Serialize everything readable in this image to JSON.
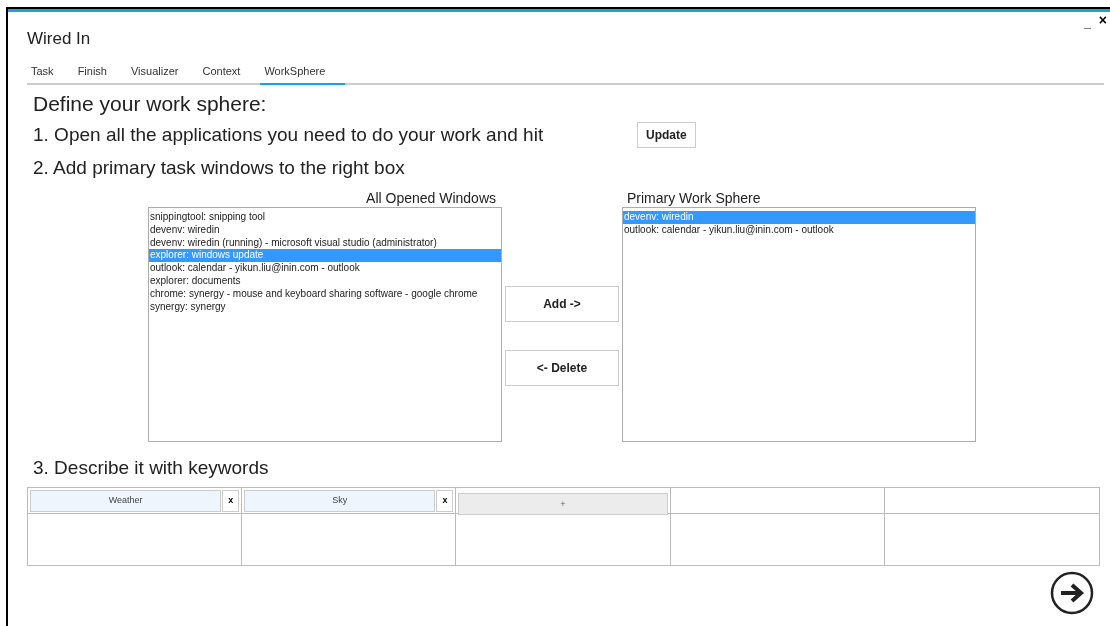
{
  "window": {
    "title": "Wired In",
    "controls": [
      {
        "kind": "minimize",
        "label": "_"
      },
      {
        "kind": "close",
        "label": "×"
      }
    ]
  },
  "tabs": [
    {
      "label": "Task",
      "selected": false
    },
    {
      "label": "Finish",
      "selected": false
    },
    {
      "label": "Visualizer",
      "selected": false
    },
    {
      "label": "Context",
      "selected": false
    },
    {
      "label": "WorkSphere",
      "selected": true
    }
  ],
  "heading": "Define your work sphere:",
  "step_1": {
    "text": "1. Open all the applications you need to do your work and hit",
    "button": "Update"
  },
  "step_2": "2. Add primary task windows to the right box",
  "all_windows": {
    "title": "All Opened Windows",
    "items": [
      {
        "label": "snippingtool: snipping tool",
        "selected": false
      },
      {
        "label": "devenv: wiredin",
        "selected": false
      },
      {
        "label": "devenv: wiredin (running) - microsoft visual studio (administrator)",
        "selected": false
      },
      {
        "label": "explorer: windows update",
        "selected": true
      },
      {
        "label": "outlook: calendar - yikun.liu@inin.com - outlook",
        "selected": false
      },
      {
        "label": "explorer: documents",
        "selected": false
      },
      {
        "label": "chrome: synergy - mouse and keyboard sharing software - google chrome",
        "selected": false
      },
      {
        "label": "synergy: synergy",
        "selected": false
      }
    ]
  },
  "move_buttons": [
    "Add ->",
    "<- Delete"
  ],
  "primary_work_sphere": {
    "title": "Primary Work Sphere",
    "items": [
      {
        "label": "devenv: wiredin",
        "selected": true
      },
      {
        "label": "outlook: calendar - yikun.liu@inin.com - outlook",
        "selected": false
      }
    ]
  },
  "step_3": "3. Describe it with keywords",
  "keywords": [
    {
      "kind": "keyword",
      "label": "Weather",
      "remove": "x"
    },
    {
      "kind": "keyword",
      "label": "Sky",
      "remove": "x"
    },
    {
      "kind": "add",
      "label": "+"
    },
    {
      "kind": "empty"
    },
    {
      "kind": "empty"
    }
  ]
}
